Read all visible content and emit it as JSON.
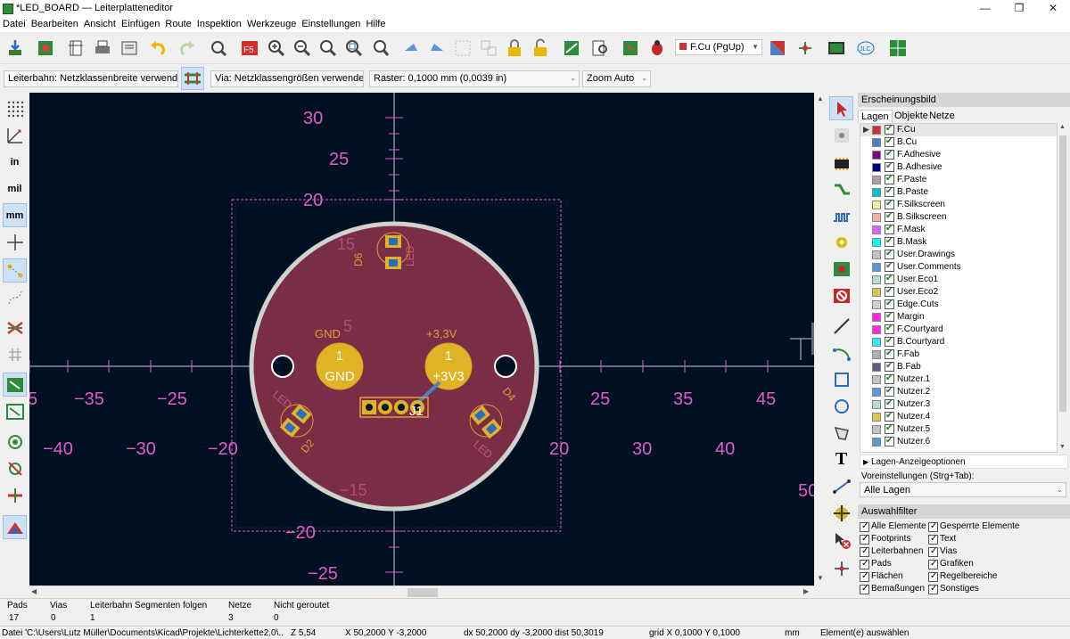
{
  "window": {
    "title": "*LED_BOARD — Leiterplatteneditor",
    "minimize": "—",
    "maximize": "❐",
    "close": "✕"
  },
  "menu": [
    "Datei",
    "Bearbeiten",
    "Ansicht",
    "Einfügen",
    "Route",
    "Inspektion",
    "Werkzeuge",
    "Einstellungen",
    "Hilfe"
  ],
  "toolbar": {
    "layer_select": "F.Cu (PgUp)"
  },
  "toolbar2": {
    "track": "Leiterbahn: Netzklassenbreite verwenden",
    "via": "Via: Netzklassengrößen verwenden",
    "grid": "Raster: 0,1000 mm (0,0039 in)",
    "zoom": "Zoom Auto"
  },
  "left_toolbar": {
    "units": {
      "in": "in",
      "mil": "mil",
      "mm": "mm"
    }
  },
  "canvas": {
    "ruler_v": [
      "30",
      "25",
      "20",
      "−20",
      "−25"
    ],
    "ruler_h_top": [
      "5",
      "−35",
      "−25",
      "25",
      "35",
      "45"
    ],
    "ruler_h_bottom": [
      "−40",
      "−30",
      "−20",
      "20",
      "30",
      "40"
    ],
    "edge_label": "50",
    "inner_ruler": [
      "15",
      "5",
      "−15"
    ],
    "pads": {
      "gnd": {
        "num": "1",
        "net": "GND",
        "label": "GND"
      },
      "v33": {
        "num": "1",
        "net": "+3V3",
        "label": "+3,3V"
      }
    },
    "refs": {
      "d6": "D6",
      "led_top": "LED",
      "d2": "D2",
      "led_left": "LED",
      "d4": "D4",
      "led_right": "LED",
      "j1": "J1"
    }
  },
  "panel": {
    "header": "Erscheinungsbild",
    "tabs": [
      "Lagen",
      "Objekte",
      "Netze"
    ],
    "layers": [
      {
        "name": "F.Cu",
        "color": "#c83434"
      },
      {
        "name": "B.Cu",
        "color": "#4d7fc4"
      },
      {
        "name": "F.Adhesive",
        "color": "#84007f"
      },
      {
        "name": "B.Adhesive",
        "color": "#000084"
      },
      {
        "name": "F.Paste",
        "color": "#b49d9d"
      },
      {
        "name": "B.Paste",
        "color": "#00c2c2"
      },
      {
        "name": "F.Silkscreen",
        "color": "#f2eda1"
      },
      {
        "name": "B.Silkscreen",
        "color": "#e8b2a7"
      },
      {
        "name": "F.Mask",
        "color": "#d864ff"
      },
      {
        "name": "B.Mask",
        "color": "#02ffee"
      },
      {
        "name": "User.Drawings",
        "color": "#c2c2c2"
      },
      {
        "name": "User.Comments",
        "color": "#5994dc"
      },
      {
        "name": "User.Eco1",
        "color": "#b4dbd2"
      },
      {
        "name": "User.Eco2",
        "color": "#d8c84a"
      },
      {
        "name": "Edge.Cuts",
        "color": "#d0d2cd"
      },
      {
        "name": "Margin",
        "color": "#ff26e2"
      },
      {
        "name": "F.Courtyard",
        "color": "#ff26e2"
      },
      {
        "name": "B.Courtyard",
        "color": "#26e9ff"
      },
      {
        "name": "F.Fab",
        "color": "#afafaf"
      },
      {
        "name": "B.Fab",
        "color": "#585d84"
      },
      {
        "name": "Nutzer.1",
        "color": "#c2c2c2"
      },
      {
        "name": "Nutzer.2",
        "color": "#5994dc"
      },
      {
        "name": "Nutzer.3",
        "color": "#b4dbd2"
      },
      {
        "name": "Nutzer.4",
        "color": "#d8c84a"
      },
      {
        "name": "Nutzer.5",
        "color": "#c2c2c2"
      },
      {
        "name": "Nutzer.6",
        "color": "#5994dc"
      }
    ],
    "display_options": "Lagen-Anzeigeoptionen",
    "presets_label": "Voreinstellungen (Strg+Tab):",
    "presets_value": "Alle Lagen",
    "filter_header": "Auswahlfilter",
    "filters_left": [
      "Alle Elemente",
      "Footprints",
      "Leiterbahnen",
      "Pads",
      "Flächen",
      "Bemaßungen"
    ],
    "filters_right": [
      "Gesperrte Elemente",
      "Text",
      "Vias",
      "Grafiken",
      "Regelbereiche",
      "Sonstiges"
    ]
  },
  "status": {
    "headers": [
      "Pads",
      "Vias",
      "Leiterbahn Segmenten folgen",
      "Netze",
      "Nicht geroutet"
    ],
    "values": [
      "17",
      "0",
      "1",
      "3",
      "0"
    ],
    "file": "Datei 'C:\\Users\\Lutz Müller\\Documents\\Kicad\\Projekte\\Lichterkette2.0\\...",
    "zoom": "Z 5,54",
    "pos": "X 50,2000  Y -3,2000",
    "delta": "dx 50,2000  dy -3,2000  dist 50,3019",
    "grid": "grid X 0,1000  Y 0,1000",
    "units": "mm",
    "mode": "Element(e) auswählen"
  }
}
